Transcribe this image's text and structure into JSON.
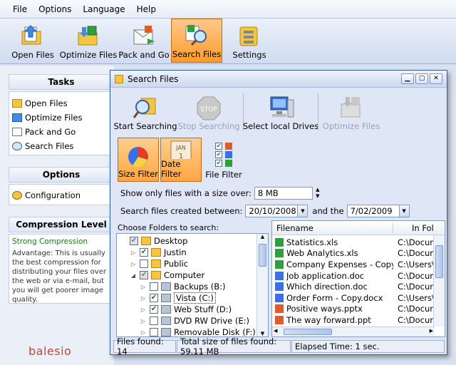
{
  "menu": [
    "File",
    "Options",
    "Language",
    "Help"
  ],
  "toolbar": [
    {
      "label": "Open Files",
      "icon": "open-files-icon"
    },
    {
      "label": "Optimize Files",
      "icon": "optimize-files-icon"
    },
    {
      "label": "Pack and Go",
      "icon": "pack-and-go-icon"
    },
    {
      "label": "Search Files",
      "icon": "search-files-icon",
      "active": true
    },
    {
      "label": "Settings",
      "icon": "settings-icon"
    }
  ],
  "left": {
    "tasks_title": "Tasks",
    "tasks": [
      "Open Files",
      "Optimize Files",
      "Pack and Go",
      "Search Files"
    ],
    "options_title": "Options",
    "options": [
      "Configuration"
    ],
    "compression_title": "Compression Level",
    "compression_level": "Strong Compression",
    "compression_desc": "Advantage: This is usually the best compression for distributing your files over the web or via e-mail, but you will get poorer image quality.",
    "logo": "balesio"
  },
  "window": {
    "title": "Search Files",
    "toolbar": [
      "Start Searching",
      "Stop Searching",
      "Select local Drives",
      "Optimize Files"
    ],
    "filters": [
      "Size Filter",
      "Date Filter",
      "File Filter"
    ],
    "size_label": "Show only files with a size over:",
    "size_value": "8 MB",
    "date_label": "Search files created between:",
    "date_from": "20/10/2008",
    "date_and": "and the",
    "date_to": "7/02/2009",
    "folders_label": "Choose Folders to search:",
    "folders": [
      {
        "label": "Desktop",
        "checked": "gray",
        "expander": "",
        "indent": 0
      },
      {
        "label": "Justin",
        "checked": "yes",
        "expander": "▷",
        "indent": 1
      },
      {
        "label": "Public",
        "checked": "no",
        "expander": "▷",
        "indent": 1
      },
      {
        "label": "Computer",
        "checked": "gray",
        "expander": "◢",
        "indent": 1
      },
      {
        "label": "Backups (B:)",
        "checked": "no",
        "expander": "▷",
        "indent": 2
      },
      {
        "label": "Vista (C:)",
        "checked": "yes",
        "expander": "▷",
        "indent": 2
      },
      {
        "label": "Web Stuff (D:)",
        "checked": "yes",
        "expander": "▷",
        "indent": 2
      },
      {
        "label": "DVD RW Drive (E:)",
        "checked": "no",
        "expander": "▷",
        "indent": 2
      },
      {
        "label": "Removable Disk (F:)",
        "checked": "no",
        "expander": "▷",
        "indent": 2
      }
    ],
    "files_header": [
      "Filename",
      "In Fol"
    ],
    "files": [
      {
        "name": "Statistics.xls",
        "path": "C:\\Docume"
      },
      {
        "name": "Web Analytics.xls",
        "path": "C:\\Docume"
      },
      {
        "name": "Company Expenses - Copy.xlsx",
        "path": "C:\\Users\\Ju"
      },
      {
        "name": "Job application.doc",
        "path": "C:\\Docume"
      },
      {
        "name": "Which direction.doc",
        "path": "C:\\Docume"
      },
      {
        "name": "Order Form - Copy.docx",
        "path": "C:\\Users\\Ju"
      },
      {
        "name": "Positive ways.pptx",
        "path": "C:\\Docume"
      },
      {
        "name": "The way forward.ppt",
        "path": "C:\\Docume"
      }
    ],
    "status": {
      "found": "Files found: 14",
      "size": "Total size of files found: 59.11 MB",
      "elapsed": "Elapsed Time: 1 sec."
    }
  }
}
